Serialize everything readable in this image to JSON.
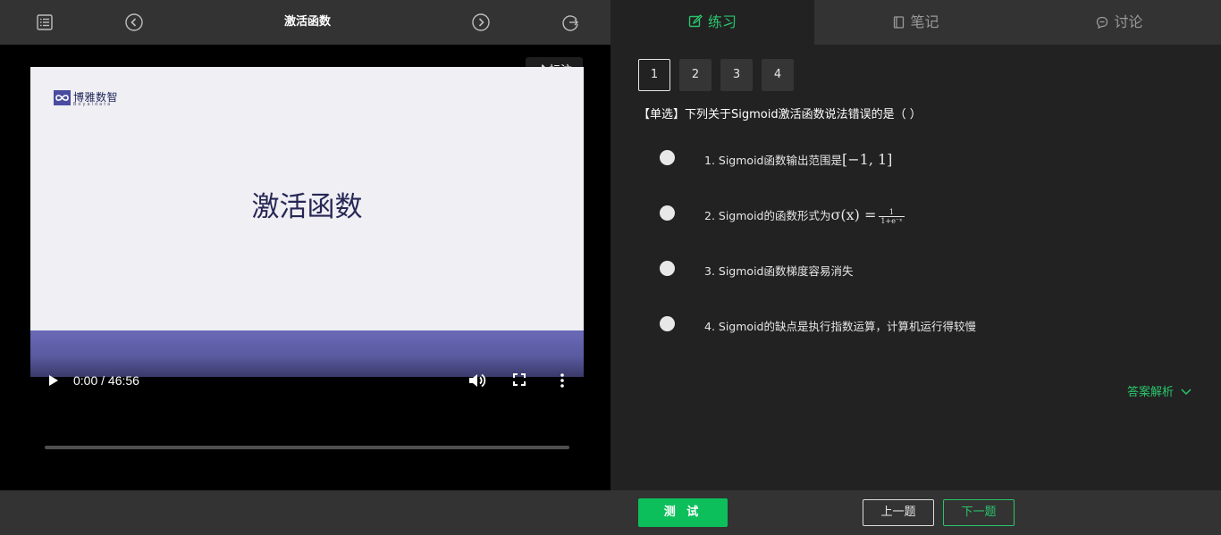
{
  "player": {
    "title": "激活函数",
    "mark_label": "标注",
    "time": "0:00 / 46:56",
    "progress": 0
  },
  "slide": {
    "logo_name": "博雅数智",
    "logo_sub": "BoyaIdata",
    "title": "激活函数"
  },
  "tabs": [
    {
      "label": "练习",
      "icon": "edit-icon",
      "active": true
    },
    {
      "label": "笔记",
      "icon": "notebook-icon",
      "active": false
    },
    {
      "label": "讨论",
      "icon": "chat-icon",
      "active": false
    }
  ],
  "question_numbers": [
    "1",
    "2",
    "3",
    "4"
  ],
  "question": {
    "text": "【单选】下列关于Sigmoid激活函数说法错误的是（ ）",
    "options": [
      {
        "text": "1. Sigmoid函数输出范围是",
        "math": "[−1, 1]"
      },
      {
        "text": "2. Sigmoid的函数形式为",
        "math": "σ(x) =",
        "frac_num": "1",
        "frac_den": "1+e⁻ˣ"
      },
      {
        "text": "3. Sigmoid函数梯度容易消失"
      },
      {
        "text": "4. Sigmoid的缺点是执行指数运算，计算机运行得较慢"
      }
    ]
  },
  "analysis_label": "答案解析",
  "buttons": {
    "test": "测 试",
    "prev": "上一题",
    "next": "下一题"
  },
  "colors": {
    "accent": "#2ac46b",
    "test_button": "#0dbf5b",
    "panel": "#222222",
    "bar": "#333333"
  }
}
